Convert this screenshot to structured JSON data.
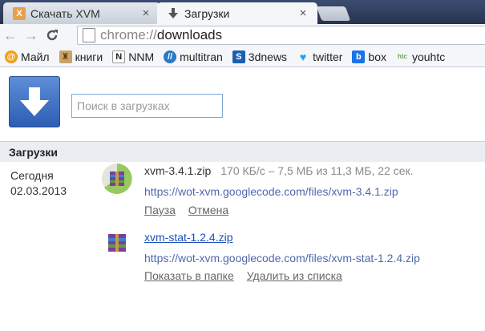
{
  "tabs": [
    {
      "title": "Скачать XVM",
      "favicon": "xvm-icon",
      "active": false
    },
    {
      "title": "Загрузки",
      "favicon": "download-icon",
      "active": true
    }
  ],
  "omnibox": {
    "scheme": "chrome://",
    "host": "downloads"
  },
  "bookmarks": [
    {
      "label": "Майл",
      "icon": "mail-ru-icon",
      "color": "#f39c12"
    },
    {
      "label": "книги",
      "icon": "books-icon",
      "color": "#8e44ad"
    },
    {
      "label": "NNM",
      "icon": "nnm-icon",
      "color": "#222222"
    },
    {
      "label": "multitran",
      "icon": "multitran-icon",
      "color": "#2b78c5"
    },
    {
      "label": "3dnews",
      "icon": "3dnews-icon",
      "color": "#1a5fb4"
    },
    {
      "label": "twitter",
      "icon": "twitter-icon",
      "color": "#1da1f2"
    },
    {
      "label": "box",
      "icon": "box-icon",
      "color": "#1a73e8"
    },
    {
      "label": "youhtc",
      "icon": "htc-icon",
      "color": "#6aa84f"
    }
  ],
  "search": {
    "placeholder": "Поиск в загрузках"
  },
  "section": {
    "title": "Загрузки"
  },
  "date": {
    "day_label": "Сегодня",
    "date": "02.03.2013"
  },
  "downloads": [
    {
      "filename": "xvm-3.4.1.zip",
      "status": "170 КБ/с – 7,5 МБ из 11,3 МБ, 22 сек.",
      "url": "https://wot-xvm.googlecode.com/files/xvm-3.4.1.zip",
      "actions": [
        "Пауза",
        "Отмена"
      ],
      "in_progress": true
    },
    {
      "filename": "xvm-stat-1.2.4.zip",
      "status": "",
      "url": "https://wot-xvm.googlecode.com/files/xvm-stat-1.2.4.zip",
      "actions": [
        "Показать в папке",
        "Удалить из списка"
      ],
      "in_progress": false
    }
  ]
}
